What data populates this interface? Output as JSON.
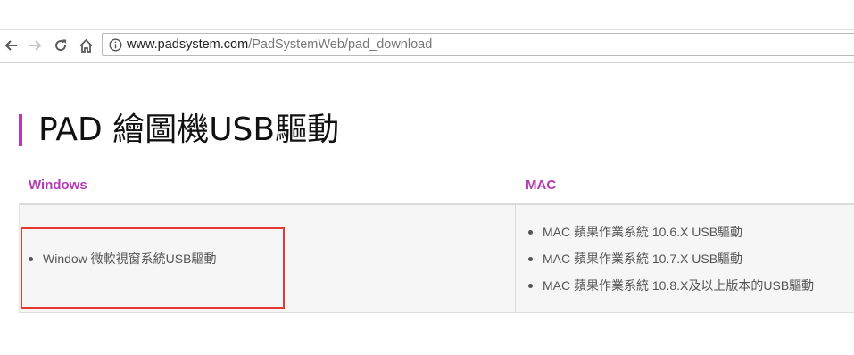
{
  "browser": {
    "url_host": "www.padsystem.com",
    "url_path": "/PadSystemWeb/pad_download"
  },
  "page": {
    "title": "PAD 繪圖機USB驅動"
  },
  "table": {
    "headers": {
      "windows": "Windows",
      "mac": "MAC"
    },
    "windows_items": [
      "Window 微軟視窗系統USB驅動"
    ],
    "mac_items": [
      "MAC 蘋果作業系統 10.6.X USB驅動",
      "MAC 蘋果作業系統 10.7.X USB驅動",
      "MAC 蘋果作業系統 10.8.X及以上版本的USB驅動"
    ]
  },
  "colors": {
    "accent": "#b83ab8",
    "highlight_box": "#e53935"
  }
}
